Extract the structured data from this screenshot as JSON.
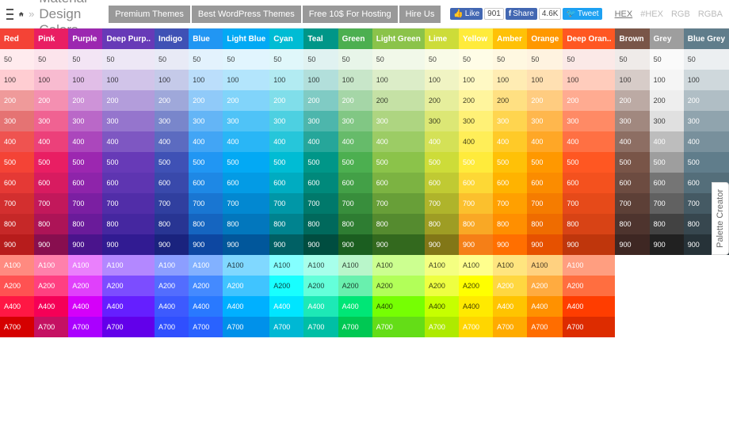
{
  "header": {
    "title": "Material Design Colors",
    "buttons": [
      "Premium Themes",
      "Best WordPress Themes",
      "Free 10$ For Hosting",
      "Hire Us"
    ],
    "social": {
      "like": "Like",
      "like_count": "901",
      "share": "Share",
      "share_count": "4.6K",
      "tweet": "Tweet"
    },
    "formats": [
      "HEX",
      "#HEX",
      "RGB",
      "RGBA"
    ],
    "active_format": 0
  },
  "side_tab": "Palette Creator",
  "shades": [
    "50",
    "100",
    "200",
    "300",
    "400",
    "500",
    "600",
    "700",
    "800",
    "900",
    "A100",
    "A200",
    "A400",
    "A700"
  ],
  "colors": [
    {
      "name": "Red",
      "hdr": "#F44336",
      "s": {
        "50": [
          "#FFEBEE",
          1
        ],
        "100": [
          "#FFCDD2",
          1
        ],
        "200": [
          "#EF9A9A",
          0
        ],
        "300": [
          "#E57373",
          0
        ],
        "400": [
          "#EF5350",
          0
        ],
        "500": [
          "#F44336",
          0
        ],
        "600": [
          "#E53935",
          0
        ],
        "700": [
          "#D32F2F",
          0
        ],
        "800": [
          "#C62828",
          0
        ],
        "900": [
          "#B71C1C",
          0
        ],
        "A100": [
          "#FF8A80",
          0
        ],
        "A200": [
          "#FF5252",
          0
        ],
        "A400": [
          "#FF1744",
          0
        ],
        "A700": [
          "#D50000",
          0
        ]
      }
    },
    {
      "name": "Pink",
      "hdr": "#E91E63",
      "s": {
        "50": [
          "#FCE4EC",
          1
        ],
        "100": [
          "#F8BBD0",
          1
        ],
        "200": [
          "#F48FB1",
          0
        ],
        "300": [
          "#F06292",
          0
        ],
        "400": [
          "#EC407A",
          0
        ],
        "500": [
          "#E91E63",
          0
        ],
        "600": [
          "#D81B60",
          0
        ],
        "700": [
          "#C2185B",
          0
        ],
        "800": [
          "#AD1457",
          0
        ],
        "900": [
          "#880E4F",
          0
        ],
        "A100": [
          "#FF80AB",
          0
        ],
        "A200": [
          "#FF4081",
          0
        ],
        "A400": [
          "#F50057",
          0
        ],
        "A700": [
          "#C51162",
          0
        ]
      }
    },
    {
      "name": "Purple",
      "hdr": "#9C27B0",
      "s": {
        "50": [
          "#F3E5F5",
          1
        ],
        "100": [
          "#E1BEE7",
          1
        ],
        "200": [
          "#CE93D8",
          0
        ],
        "300": [
          "#BA68C8",
          0
        ],
        "400": [
          "#AB47BC",
          0
        ],
        "500": [
          "#9C27B0",
          0
        ],
        "600": [
          "#8E24AA",
          0
        ],
        "700": [
          "#7B1FA2",
          0
        ],
        "800": [
          "#6A1B9A",
          0
        ],
        "900": [
          "#4A148C",
          0
        ],
        "A100": [
          "#EA80FC",
          0
        ],
        "A200": [
          "#E040FB",
          0
        ],
        "A400": [
          "#D500F9",
          0
        ],
        "A700": [
          "#AA00FF",
          0
        ]
      }
    },
    {
      "name": "Deep Purp..",
      "hdr": "#673AB7",
      "s": {
        "50": [
          "#EDE7F6",
          1
        ],
        "100": [
          "#D1C4E9",
          1
        ],
        "200": [
          "#B39DDB",
          0
        ],
        "300": [
          "#9575CD",
          0
        ],
        "400": [
          "#7E57C2",
          0
        ],
        "500": [
          "#673AB7",
          0
        ],
        "600": [
          "#5E35B1",
          0
        ],
        "700": [
          "#512DA8",
          0
        ],
        "800": [
          "#4527A0",
          0
        ],
        "900": [
          "#311B92",
          0
        ],
        "A100": [
          "#B388FF",
          0
        ],
        "A200": [
          "#7C4DFF",
          0
        ],
        "A400": [
          "#651FFF",
          0
        ],
        "A700": [
          "#6200EA",
          0
        ]
      }
    },
    {
      "name": "Indigo",
      "hdr": "#3F51B5",
      "s": {
        "50": [
          "#E8EAF6",
          1
        ],
        "100": [
          "#C5CAE9",
          1
        ],
        "200": [
          "#9FA8DA",
          0
        ],
        "300": [
          "#7986CB",
          0
        ],
        "400": [
          "#5C6BC0",
          0
        ],
        "500": [
          "#3F51B5",
          0
        ],
        "600": [
          "#3949AB",
          0
        ],
        "700": [
          "#303F9F",
          0
        ],
        "800": [
          "#283593",
          0
        ],
        "900": [
          "#1A237E",
          0
        ],
        "A100": [
          "#8C9EFF",
          0
        ],
        "A200": [
          "#536DFE",
          0
        ],
        "A400": [
          "#3D5AFE",
          0
        ],
        "A700": [
          "#304FFE",
          0
        ]
      }
    },
    {
      "name": "Blue",
      "hdr": "#2196F3",
      "s": {
        "50": [
          "#E3F2FD",
          1
        ],
        "100": [
          "#BBDEFB",
          1
        ],
        "200": [
          "#90CAF9",
          0
        ],
        "300": [
          "#64B5F6",
          0
        ],
        "400": [
          "#42A5F5",
          0
        ],
        "500": [
          "#2196F3",
          0
        ],
        "600": [
          "#1E88E5",
          0
        ],
        "700": [
          "#1976D2",
          0
        ],
        "800": [
          "#1565C0",
          0
        ],
        "900": [
          "#0D47A1",
          0
        ],
        "A100": [
          "#82B1FF",
          0
        ],
        "A200": [
          "#448AFF",
          0
        ],
        "A400": [
          "#2979FF",
          0
        ],
        "A700": [
          "#2962FF",
          0
        ]
      }
    },
    {
      "name": "Light Blue",
      "hdr": "#03A9F4",
      "s": {
        "50": [
          "#E1F5FE",
          1
        ],
        "100": [
          "#B3E5FC",
          1
        ],
        "200": [
          "#81D4FA",
          0
        ],
        "300": [
          "#4FC3F7",
          0
        ],
        "400": [
          "#29B6F6",
          0
        ],
        "500": [
          "#03A9F4",
          0
        ],
        "600": [
          "#039BE5",
          0
        ],
        "700": [
          "#0288D1",
          0
        ],
        "800": [
          "#0277BD",
          0
        ],
        "900": [
          "#01579B",
          0
        ],
        "A100": [
          "#80D8FF",
          1
        ],
        "A200": [
          "#40C4FF",
          0
        ],
        "A400": [
          "#00B0FF",
          0
        ],
        "A700": [
          "#0091EA",
          0
        ]
      }
    },
    {
      "name": "Cyan",
      "hdr": "#00BCD4",
      "s": {
        "50": [
          "#E0F7FA",
          1
        ],
        "100": [
          "#B2EBF2",
          1
        ],
        "200": [
          "#80DEEA",
          0
        ],
        "300": [
          "#4DD0E1",
          0
        ],
        "400": [
          "#26C6DA",
          0
        ],
        "500": [
          "#00BCD4",
          0
        ],
        "600": [
          "#00ACC1",
          0
        ],
        "700": [
          "#0097A7",
          0
        ],
        "800": [
          "#00838F",
          0
        ],
        "900": [
          "#006064",
          0
        ],
        "A100": [
          "#84FFFF",
          1
        ],
        "A200": [
          "#18FFFF",
          1
        ],
        "A400": [
          "#00E5FF",
          0
        ],
        "A700": [
          "#00B8D4",
          0
        ]
      }
    },
    {
      "name": "Teal",
      "hdr": "#009688",
      "s": {
        "50": [
          "#E0F2F1",
          1
        ],
        "100": [
          "#B2DFDB",
          1
        ],
        "200": [
          "#80CBC4",
          0
        ],
        "300": [
          "#4DB6AC",
          0
        ],
        "400": [
          "#26A69A",
          0
        ],
        "500": [
          "#009688",
          0
        ],
        "600": [
          "#00897B",
          0
        ],
        "700": [
          "#00796B",
          0
        ],
        "800": [
          "#00695C",
          0
        ],
        "900": [
          "#004D40",
          0
        ],
        "A100": [
          "#A7FFEB",
          1
        ],
        "A200": [
          "#64FFDA",
          1
        ],
        "A400": [
          "#1DE9B6",
          0
        ],
        "A700": [
          "#00BFA5",
          0
        ]
      }
    },
    {
      "name": "Green",
      "hdr": "#4CAF50",
      "s": {
        "50": [
          "#E8F5E9",
          1
        ],
        "100": [
          "#C8E6C9",
          1
        ],
        "200": [
          "#A5D6A7",
          0
        ],
        "300": [
          "#81C784",
          0
        ],
        "400": [
          "#66BB6A",
          0
        ],
        "500": [
          "#4CAF50",
          0
        ],
        "600": [
          "#43A047",
          0
        ],
        "700": [
          "#388E3C",
          0
        ],
        "800": [
          "#2E7D32",
          0
        ],
        "900": [
          "#1B5E20",
          0
        ],
        "A100": [
          "#B9F6CA",
          1
        ],
        "A200": [
          "#69F0AE",
          1
        ],
        "A400": [
          "#00E676",
          0
        ],
        "A700": [
          "#00C853",
          0
        ]
      }
    },
    {
      "name": "Light Green",
      "hdr": "#8BC34A",
      "s": {
        "50": [
          "#F1F8E9",
          1
        ],
        "100": [
          "#DCEDC8",
          1
        ],
        "200": [
          "#C5E1A5",
          1
        ],
        "300": [
          "#AED581",
          0
        ],
        "400": [
          "#9CCC65",
          0
        ],
        "500": [
          "#8BC34A",
          0
        ],
        "600": [
          "#7CB342",
          0
        ],
        "700": [
          "#689F38",
          0
        ],
        "800": [
          "#558B2F",
          0
        ],
        "900": [
          "#33691E",
          0
        ],
        "A100": [
          "#CCFF90",
          1
        ],
        "A200": [
          "#B2FF59",
          1
        ],
        "A400": [
          "#76FF03",
          1
        ],
        "A700": [
          "#64DD17",
          0
        ]
      }
    },
    {
      "name": "Lime",
      "hdr": "#CDDC39",
      "s": {
        "50": [
          "#F9FBE7",
          1
        ],
        "100": [
          "#F0F4C3",
          1
        ],
        "200": [
          "#E6EE9C",
          1
        ],
        "300": [
          "#DCE775",
          1
        ],
        "400": [
          "#D4E157",
          0
        ],
        "500": [
          "#CDDC39",
          0
        ],
        "600": [
          "#C0CA33",
          0
        ],
        "700": [
          "#AFB42B",
          0
        ],
        "800": [
          "#9E9D24",
          0
        ],
        "900": [
          "#827717",
          0
        ],
        "A100": [
          "#F4FF81",
          1
        ],
        "A200": [
          "#EEFF41",
          1
        ],
        "A400": [
          "#C6FF00",
          1
        ],
        "A700": [
          "#AEEA00",
          0
        ]
      }
    },
    {
      "name": "Yellow",
      "hdr": "#FFEB3B",
      "s": {
        "50": [
          "#FFFDE7",
          1
        ],
        "100": [
          "#FFF9C4",
          1
        ],
        "200": [
          "#FFF59D",
          1
        ],
        "300": [
          "#FFF176",
          1
        ],
        "400": [
          "#FFEE58",
          1
        ],
        "500": [
          "#FFEB3B",
          0
        ],
        "600": [
          "#FDD835",
          0
        ],
        "700": [
          "#FBC02D",
          0
        ],
        "800": [
          "#F9A825",
          0
        ],
        "900": [
          "#F57F17",
          0
        ],
        "A100": [
          "#FFFF8D",
          1
        ],
        "A200": [
          "#FFFF00",
          1
        ],
        "A400": [
          "#FFEA00",
          1
        ],
        "A700": [
          "#FFD600",
          0
        ]
      }
    },
    {
      "name": "Amber",
      "hdr": "#FFC107",
      "s": {
        "50": [
          "#FFF8E1",
          1
        ],
        "100": [
          "#FFECB3",
          1
        ],
        "200": [
          "#FFE082",
          1
        ],
        "300": [
          "#FFD54F",
          0
        ],
        "400": [
          "#FFCA28",
          0
        ],
        "500": [
          "#FFC107",
          0
        ],
        "600": [
          "#FFB300",
          0
        ],
        "700": [
          "#FFA000",
          0
        ],
        "800": [
          "#FF8F00",
          0
        ],
        "900": [
          "#FF6F00",
          0
        ],
        "A100": [
          "#FFE57F",
          1
        ],
        "A200": [
          "#FFD740",
          0
        ],
        "A400": [
          "#FFC400",
          0
        ],
        "A700": [
          "#FFAB00",
          0
        ]
      }
    },
    {
      "name": "Orange",
      "hdr": "#FF9800",
      "s": {
        "50": [
          "#FFF3E0",
          1
        ],
        "100": [
          "#FFE0B2",
          1
        ],
        "200": [
          "#FFCC80",
          0
        ],
        "300": [
          "#FFB74D",
          0
        ],
        "400": [
          "#FFA726",
          0
        ],
        "500": [
          "#FF9800",
          0
        ],
        "600": [
          "#FB8C00",
          0
        ],
        "700": [
          "#F57C00",
          0
        ],
        "800": [
          "#EF6C00",
          0
        ],
        "900": [
          "#E65100",
          0
        ],
        "A100": [
          "#FFD180",
          1
        ],
        "A200": [
          "#FFAB40",
          0
        ],
        "A400": [
          "#FF9100",
          0
        ],
        "A700": [
          "#FF6D00",
          0
        ]
      }
    },
    {
      "name": "Deep Oran..",
      "hdr": "#FF5722",
      "s": {
        "50": [
          "#FBE9E7",
          1
        ],
        "100": [
          "#FFCCBC",
          1
        ],
        "200": [
          "#FFAB91",
          0
        ],
        "300": [
          "#FF8A65",
          0
        ],
        "400": [
          "#FF7043",
          0
        ],
        "500": [
          "#FF5722",
          0
        ],
        "600": [
          "#F4511E",
          0
        ],
        "700": [
          "#E64A19",
          0
        ],
        "800": [
          "#D84315",
          0
        ],
        "900": [
          "#BF360C",
          0
        ],
        "A100": [
          "#FF9E80",
          0
        ],
        "A200": [
          "#FF6E40",
          0
        ],
        "A400": [
          "#FF3D00",
          0
        ],
        "A700": [
          "#DD2C00",
          0
        ]
      }
    },
    {
      "name": "Brown",
      "hdr": "#795548",
      "noA": true,
      "s": {
        "50": [
          "#EFEBE9",
          1
        ],
        "100": [
          "#D7CCC8",
          1
        ],
        "200": [
          "#BCAAA4",
          0
        ],
        "300": [
          "#A1887F",
          0
        ],
        "400": [
          "#8D6E63",
          0
        ],
        "500": [
          "#795548",
          0
        ],
        "600": [
          "#6D4C41",
          0
        ],
        "700": [
          "#5D4037",
          0
        ],
        "800": [
          "#4E342E",
          0
        ],
        "900": [
          "#3E2723",
          0
        ]
      }
    },
    {
      "name": "Grey",
      "hdr": "#9E9E9E",
      "noA": true,
      "s": {
        "50": [
          "#FAFAFA",
          1
        ],
        "100": [
          "#F5F5F5",
          1
        ],
        "200": [
          "#EEEEEE",
          1
        ],
        "300": [
          "#E0E0E0",
          1
        ],
        "400": [
          "#BDBDBD",
          0
        ],
        "500": [
          "#9E9E9E",
          0
        ],
        "600": [
          "#757575",
          0
        ],
        "700": [
          "#616161",
          0
        ],
        "800": [
          "#424242",
          0
        ],
        "900": [
          "#212121",
          0
        ]
      }
    },
    {
      "name": "Blue Grey",
      "hdr": "#607D8B",
      "noA": true,
      "s": {
        "50": [
          "#ECEFF1",
          1
        ],
        "100": [
          "#CFD8DC",
          1
        ],
        "200": [
          "#B0BEC5",
          0
        ],
        "300": [
          "#90A4AE",
          0
        ],
        "400": [
          "#78909C",
          0
        ],
        "500": [
          "#607D8B",
          0
        ],
        "600": [
          "#546E7A",
          0
        ],
        "700": [
          "#455A64",
          0
        ],
        "800": [
          "#37474F",
          0
        ],
        "900": [
          "#263238",
          0
        ]
      }
    }
  ]
}
